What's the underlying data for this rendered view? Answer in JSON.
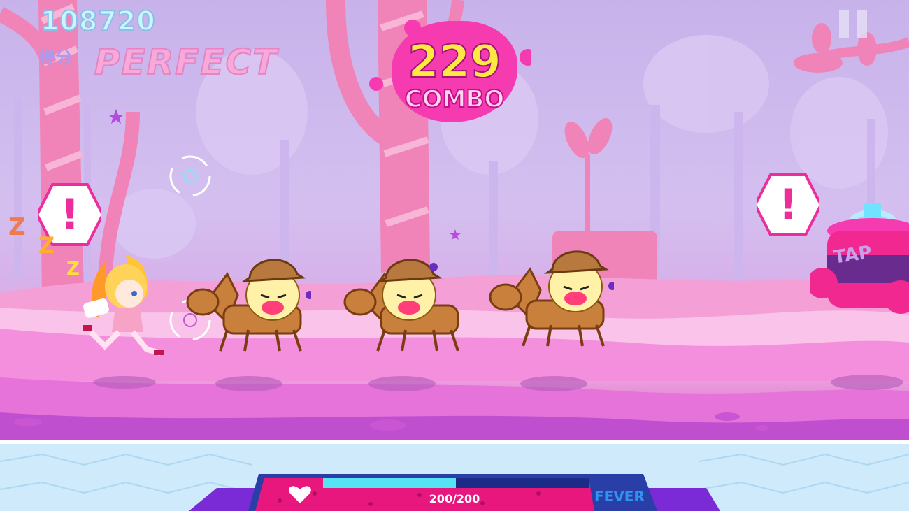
{
  "hud": {
    "score": "108720",
    "score_label": "得分",
    "judgement": "PERFECT",
    "combo_number": "229",
    "combo_label": "COMBO",
    "hp_text": "200/200",
    "hp_fraction": 1.0,
    "fever_label": "FEVER",
    "fever_fraction": 0.5
  },
  "alerts": {
    "left": "!",
    "right": "!"
  },
  "tap_target": {
    "label": "TAP"
  },
  "sleep_marks": [
    "Z",
    "Z",
    "Z"
  ],
  "colors": {
    "sky": "#c7b3ea",
    "ground": "#f2b8e6",
    "combo_blob": "#f63bb0",
    "combo_number": "#ffe842",
    "fever": "#2f93f0",
    "hp_bar": "#e8177d"
  }
}
